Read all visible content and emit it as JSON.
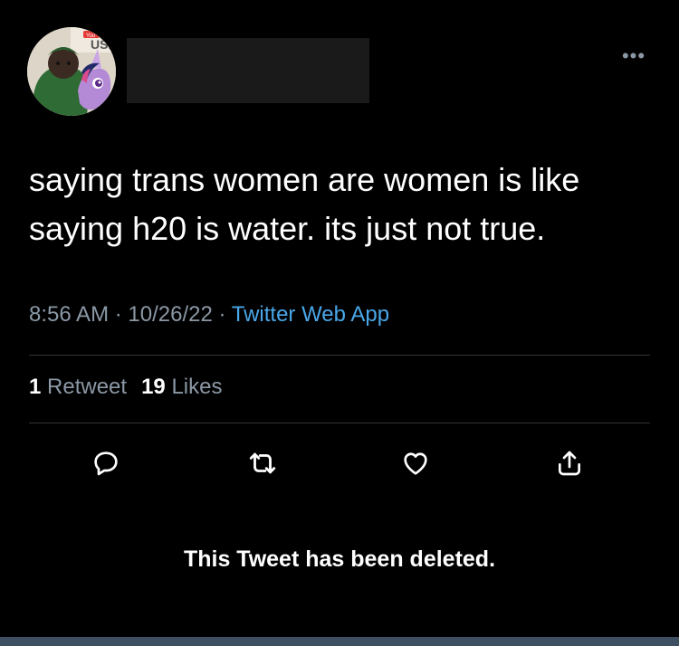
{
  "tweet": {
    "text_line1": "saying trans women are women is like",
    "text_line2": "saying h20 is water. its just not true.",
    "time": "8:56 AM",
    "date": "10/26/22",
    "separator": "·",
    "source": "Twitter Web App",
    "retweet_count": "1",
    "retweet_label": "Retweet",
    "like_count": "19",
    "like_label": "Likes"
  },
  "deleted_notice": "This Tweet has been deleted.",
  "more_label": "•••",
  "avatar_logo_text": "You",
  "avatar_banner_text": "USIC",
  "icons": [
    "reply-icon",
    "retweet-icon",
    "like-icon",
    "share-icon"
  ],
  "colors": {
    "background": "#000000",
    "text": "#ffffff",
    "muted": "#8b98a5",
    "link": "#4aa7e8",
    "divider": "#2f3336"
  }
}
